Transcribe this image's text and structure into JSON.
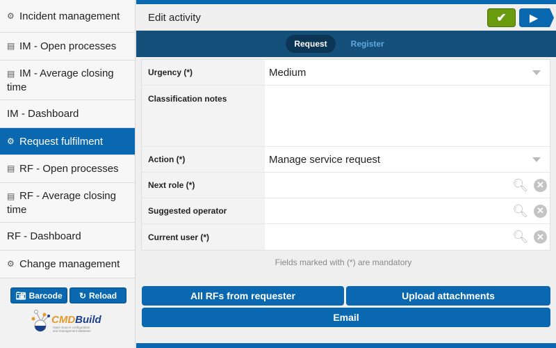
{
  "sidebar": {
    "items": [
      {
        "label": "Incident management",
        "icon": "gear-icon"
      },
      {
        "label": "IM - Open processes",
        "icon": "report-icon"
      },
      {
        "label": "IM - Average closing time",
        "icon": "report-icon"
      },
      {
        "label": "IM - Dashboard",
        "icon": ""
      },
      {
        "label": "Request fulfilment",
        "icon": "gear-icon",
        "selected": true
      },
      {
        "label": "RF - Open processes",
        "icon": "report-icon"
      },
      {
        "label": "RF - Average closing time",
        "icon": "report-icon"
      },
      {
        "label": "RF - Dashboard",
        "icon": ""
      },
      {
        "label": "Change management",
        "icon": "gear-icon"
      }
    ],
    "barcode_label": "Barcode",
    "reload_label": "Reload",
    "logo": {
      "name": "CMDBuild",
      "tagline": "Open Source configuration and management database"
    }
  },
  "header": {
    "title": "Edit activity"
  },
  "tabs": [
    {
      "label": "Request",
      "active": true
    },
    {
      "label": "Register"
    }
  ],
  "form": {
    "urgency": {
      "label": "Urgency (*)",
      "value": "Medium"
    },
    "classification": {
      "label": "Classification notes",
      "value": ""
    },
    "action": {
      "label": "Action (*)",
      "value": "Manage service request"
    },
    "next_role": {
      "label": "Next role (*)",
      "value": ""
    },
    "suggested_operator": {
      "label": "Suggested operator",
      "value": ""
    },
    "current_user": {
      "label": "Current user (*)",
      "value": ""
    }
  },
  "mandatory_note": "Fields marked with (*) are mandatory",
  "actions": {
    "all_rfs": "All RFs from requester",
    "upload": "Upload attachments",
    "email": "Email"
  },
  "colors": {
    "primary": "#0a68b0",
    "tabbar": "#15507a",
    "confirm": "#6a9a0e"
  }
}
